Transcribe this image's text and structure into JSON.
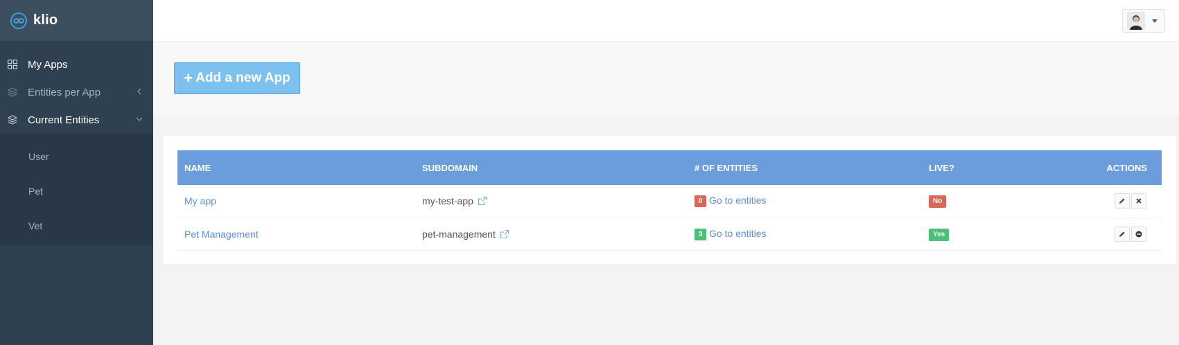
{
  "brand": {
    "name": "klio"
  },
  "sidebar": {
    "items": [
      {
        "label": "My Apps",
        "icon": "grid-icon",
        "state": "active"
      },
      {
        "label": "Entities per App",
        "icon": "layers-icon",
        "state": "muted"
      },
      {
        "label": "Current Entities",
        "icon": "layers-icon",
        "state": "active"
      }
    ],
    "subitems": [
      {
        "label": "User"
      },
      {
        "label": "Pet"
      },
      {
        "label": "Vet"
      }
    ]
  },
  "header": {
    "add_button_label": "Add a new App"
  },
  "table": {
    "columns": [
      "NAME",
      "SUBDOMAIN",
      "# OF ENTITIES",
      "LIVE?",
      "ACTIONS"
    ],
    "rows": [
      {
        "name": "My app",
        "subdomain": "my-test-app",
        "entity_count": "0",
        "entities_link": "Go to entities",
        "live": "No"
      },
      {
        "name": "Pet Management",
        "subdomain": "pet-management",
        "entity_count": "3",
        "entities_link": "Go to entities",
        "live": "Yes"
      }
    ]
  },
  "colors": {
    "sidebar_bg": "#2f4050",
    "header_row": "#6b9ddc",
    "badge_zero": "#d9675a",
    "badge_positive": "#4cbf78",
    "live_no": "#d9675a",
    "live_yes": "#4cbf78",
    "link": "#5b8fd6",
    "accent_button": "#7dc1ee"
  },
  "icons": {
    "edit": "pencil-icon",
    "delete_row_1": "close-icon",
    "delete_row_2": "minus-circle-icon",
    "external": "external-link-icon"
  }
}
